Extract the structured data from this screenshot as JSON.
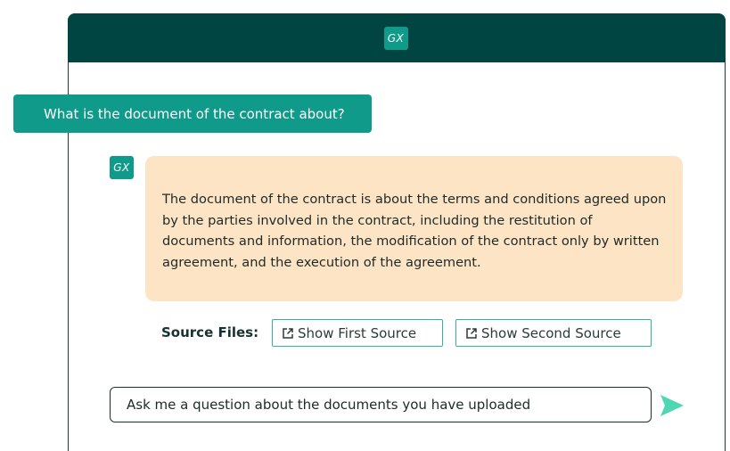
{
  "header": {
    "logo_text": "GX"
  },
  "conversation": {
    "user_message": "What is the document of the contract about?",
    "bot_avatar_text": "GX",
    "bot_response": "The document of the contract is about the terms and conditions agreed upon by the parties involved in the contract, including the restitution of documents and information, the modification of the contract only by written agreement, and the execution of the agreement."
  },
  "sources": {
    "label": "Source Files:",
    "buttons": [
      {
        "label": "Show First Source",
        "icon": "external-link-icon"
      },
      {
        "label": "Show Second Source",
        "icon": "external-link-icon"
      }
    ]
  },
  "input": {
    "placeholder": "Ask me a question about the documents you have uploaded",
    "value": ""
  },
  "send": {
    "icon": "send-arrow-icon"
  },
  "colors": {
    "header_bg": "#004541",
    "accent": "#0f9a8a",
    "bot_bubble_bg": "#fde4c5",
    "send_icon": "#4fd6b3",
    "source_border": "#2fb3a0"
  }
}
